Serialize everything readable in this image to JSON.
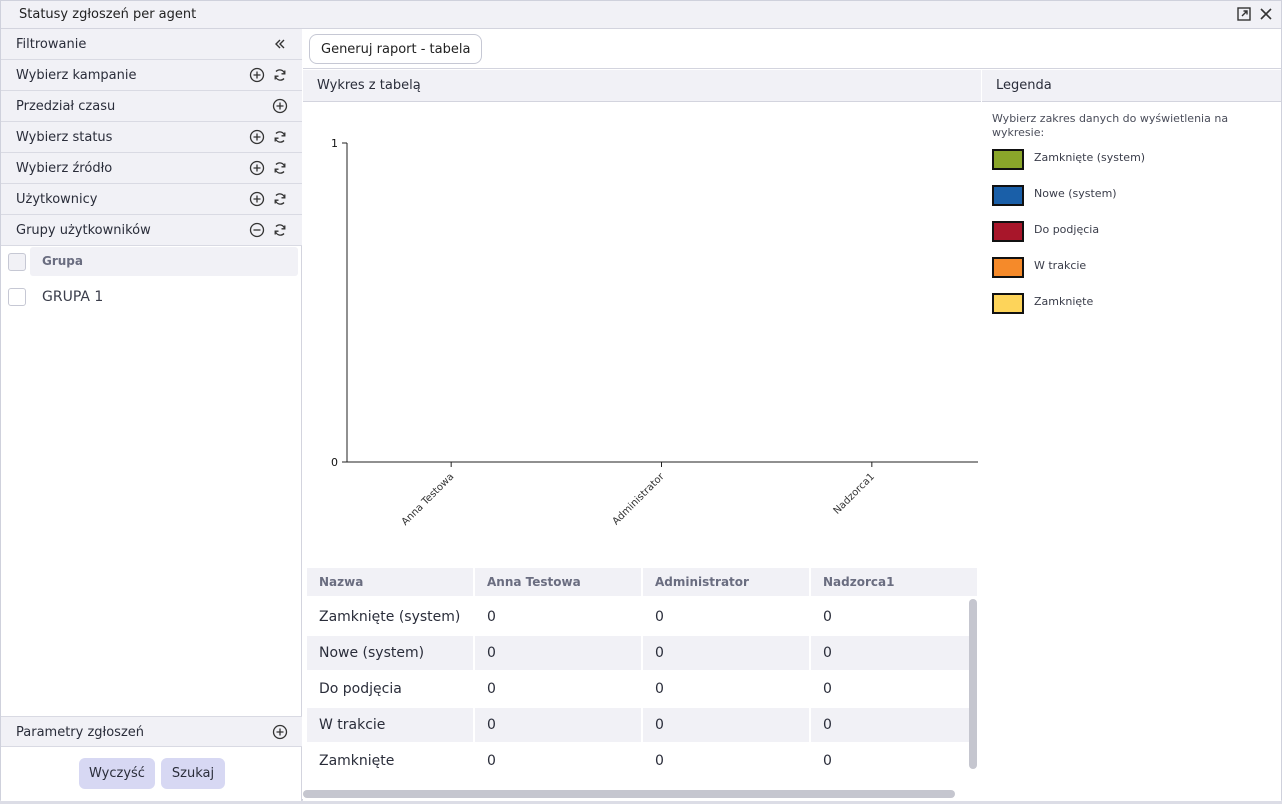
{
  "window": {
    "title": "Statusy zgłoszeń per agent"
  },
  "sidebar": {
    "filter_header": "Filtrowanie",
    "sections": [
      {
        "label": "Wybierz kampanie"
      },
      {
        "label": "Przedział czasu"
      },
      {
        "label": "Wybierz status"
      },
      {
        "label": "Wybierz źródło"
      },
      {
        "label": "Użytkownicy"
      },
      {
        "label": "Grupy użytkowników"
      }
    ],
    "groups_table": {
      "header": "Grupa",
      "rows": [
        "GRUPA 1"
      ]
    },
    "params_section": "Parametry zgłoszeń",
    "clear_button": "Wyczyść",
    "search_button": "Szukaj"
  },
  "toolbar": {
    "generate_button": "Generuj raport - tabela"
  },
  "chart_panel": {
    "title": "Wykres z tabelą"
  },
  "legend": {
    "title": "Legenda",
    "description": "Wybierz zakres danych do wyświetlenia na wykresie:",
    "items": [
      {
        "label": "Zamknięte (system)",
        "color": "#8aa62a"
      },
      {
        "label": "Nowe (system)",
        "color": "#1a5fa8"
      },
      {
        "label": "Do podjęcia",
        "color": "#a8162a"
      },
      {
        "label": "W trakcie",
        "color": "#f58a2a"
      },
      {
        "label": "Zamknięte",
        "color": "#fdd45a"
      }
    ]
  },
  "chart_data": {
    "type": "bar",
    "categories": [
      "Anna Testowa",
      "Administrator",
      "Nadzorca1"
    ],
    "series": [
      {
        "name": "Zamknięte (system)",
        "values": [
          0,
          0,
          0
        ]
      },
      {
        "name": "Nowe (system)",
        "values": [
          0,
          0,
          0
        ]
      },
      {
        "name": "Do podjęcia",
        "values": [
          0,
          0,
          0
        ]
      },
      {
        "name": "W trakcie",
        "values": [
          0,
          0,
          0
        ]
      },
      {
        "name": "Zamknięte",
        "values": [
          0,
          0,
          0
        ]
      }
    ],
    "ylim": [
      0,
      1
    ],
    "yticks": [
      "0",
      "1"
    ],
    "grid": false
  },
  "table": {
    "headers": [
      "Nazwa",
      "Anna Testowa",
      "Administrator",
      "Nadzorca1"
    ],
    "rows": [
      [
        "Zamknięte (system)",
        "0",
        "0",
        "0"
      ],
      [
        "Nowe (system)",
        "0",
        "0",
        "0"
      ],
      [
        "Do podjęcia",
        "0",
        "0",
        "0"
      ],
      [
        "W trakcie",
        "0",
        "0",
        "0"
      ],
      [
        "Zamknięte",
        "0",
        "0",
        "0"
      ]
    ]
  }
}
